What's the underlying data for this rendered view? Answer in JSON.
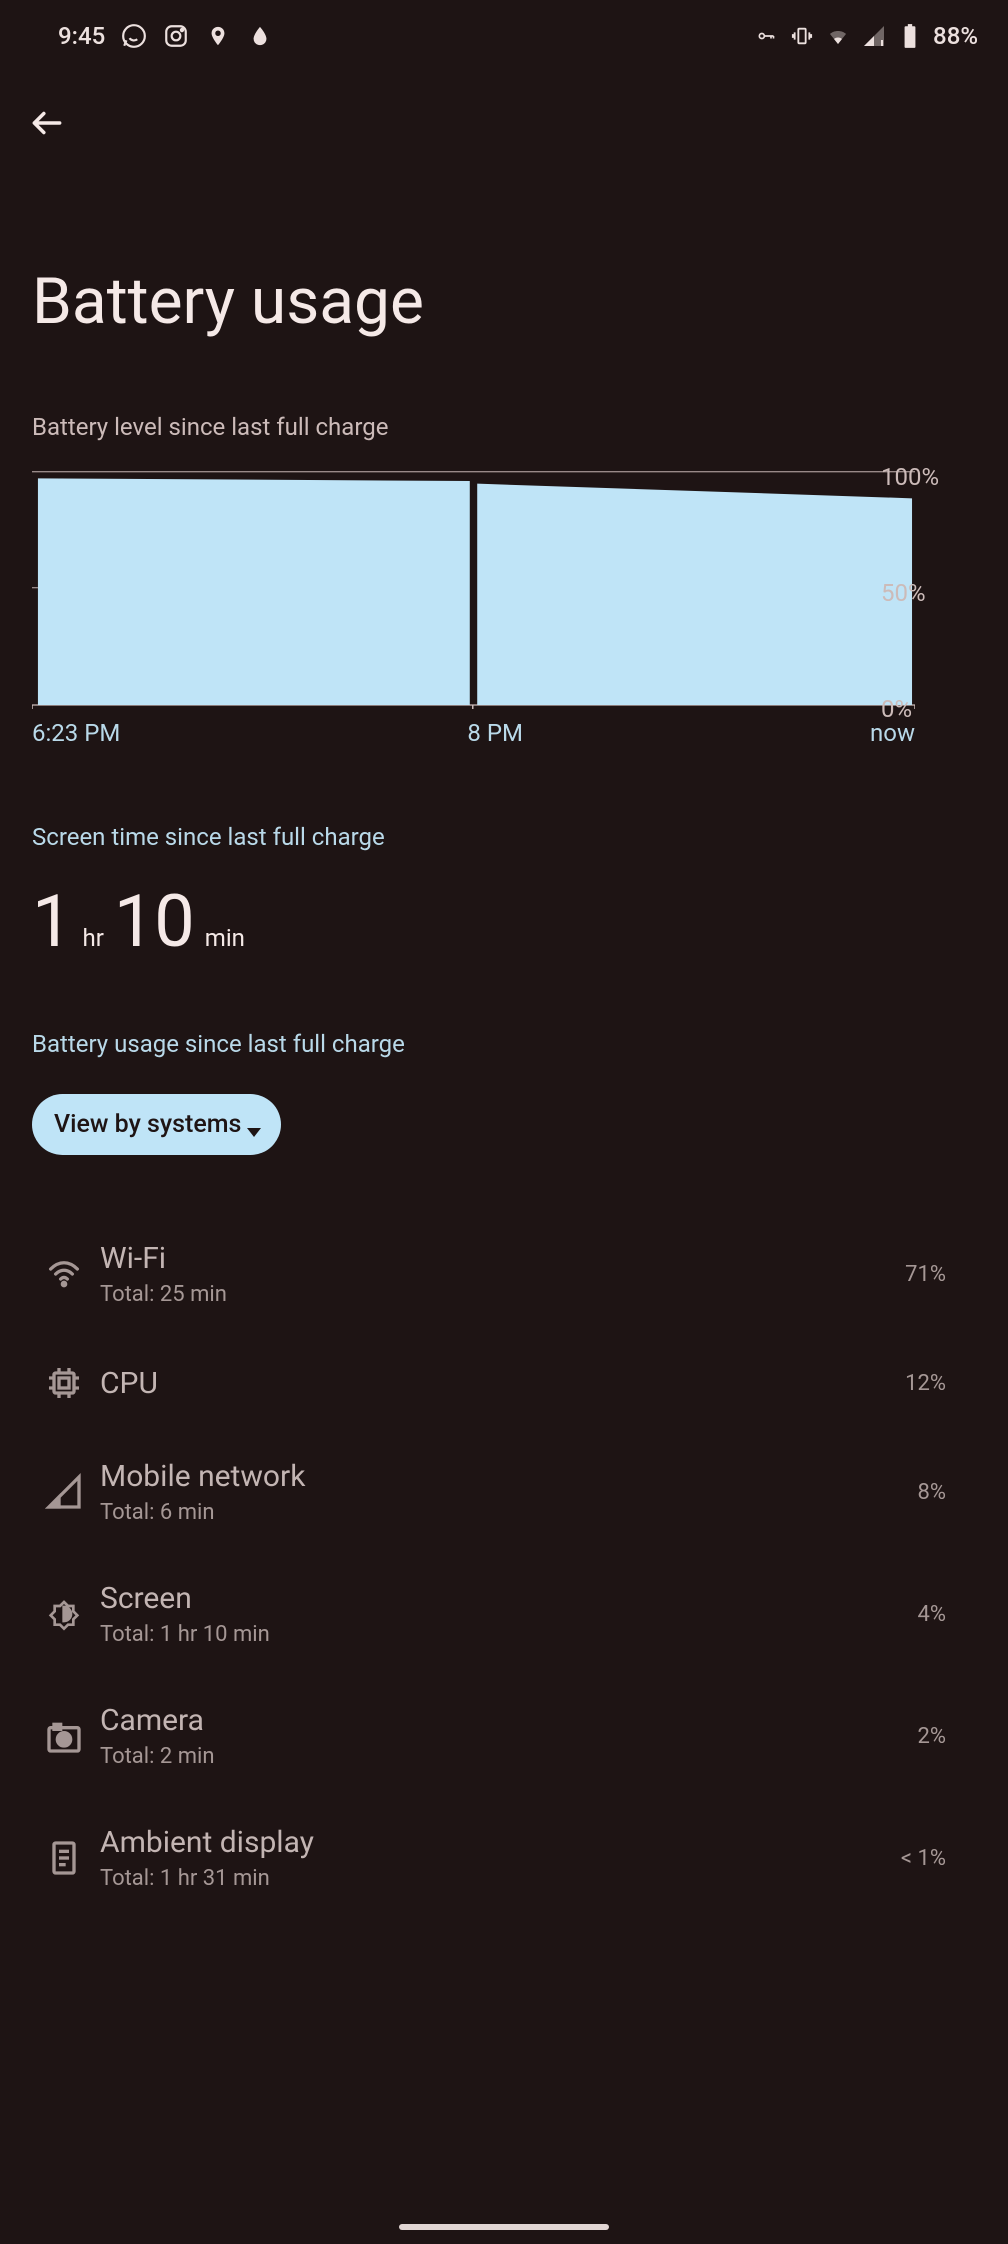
{
  "status_bar": {
    "time": "9:45",
    "battery_text": "88%"
  },
  "page": {
    "title": "Battery usage",
    "sub_level": "Battery level since last full charge",
    "screen_time_head": "Screen time since last full charge",
    "screen_time": {
      "h": "1",
      "h_unit": "hr",
      "m": "10",
      "m_unit": "min"
    },
    "usage_head": "Battery usage since last full charge",
    "view_pill": "View by systems"
  },
  "chart_data": {
    "type": "area",
    "x_labels": [
      "6:23 PM",
      "8 PM",
      "now"
    ],
    "y_ticks": [
      "100%",
      "50%",
      "0%"
    ],
    "ylim": [
      0,
      100
    ],
    "series": [
      {
        "name": "battery",
        "points": [
          {
            "x": 0,
            "y": 97
          },
          {
            "x": 50,
            "y": 96
          },
          {
            "x": 50,
            "y": null
          },
          {
            "x": 50.5,
            "y": 95
          },
          {
            "x": 100,
            "y": 88
          }
        ]
      }
    ]
  },
  "items": [
    {
      "icon": "wifi",
      "name": "Wi-Fi",
      "sub": "Total: 25 min",
      "pct": "71%"
    },
    {
      "icon": "cpu",
      "name": "CPU",
      "sub": "",
      "pct": "12%"
    },
    {
      "icon": "signal",
      "name": "Mobile network",
      "sub": "Total: 6 min",
      "pct": "8%"
    },
    {
      "icon": "bright",
      "name": "Screen",
      "sub": "Total: 1 hr 10 min",
      "pct": "4%"
    },
    {
      "icon": "camera",
      "name": "Camera",
      "sub": "Total: 2 min",
      "pct": "2%"
    },
    {
      "icon": "ambient",
      "name": "Ambient display",
      "sub": "Total: 1 hr 31 min",
      "pct": "< 1%"
    }
  ]
}
